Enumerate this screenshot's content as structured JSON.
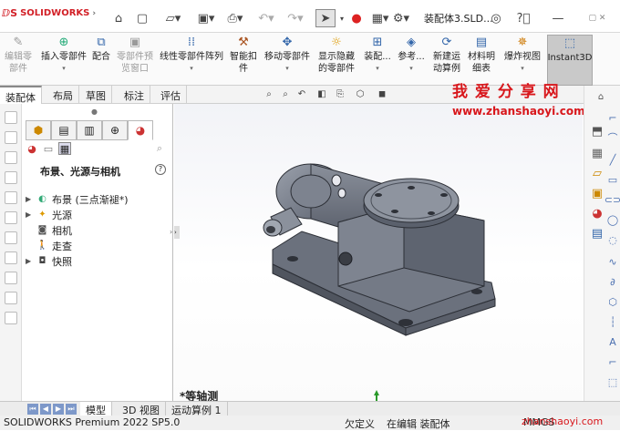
{
  "app": {
    "logo_text": "SOLIDWORKS",
    "document_title": "装配体3.SLD..."
  },
  "quick_access": [
    "home-icon",
    "new-document-icon",
    "open-folder-icon",
    "save-icon",
    "print-icon",
    "undo-icon",
    "redo-icon",
    "select-pointer-icon",
    "traffic-light-icon",
    "options-gear-icon"
  ],
  "title_icons": [
    "user-icon",
    "help-icon",
    "minimize-icon"
  ],
  "ribbon": {
    "buttons": [
      {
        "label": "编辑零\n部件",
        "disabled": true
      },
      {
        "label": "插入零部件",
        "disabled": false
      },
      {
        "label": "配合",
        "disabled": false
      },
      {
        "label": "零部件预\n览窗口",
        "disabled": true
      },
      {
        "label": "线性零部件阵列",
        "disabled": false
      },
      {
        "label": "智能扣\n件",
        "disabled": false
      },
      {
        "label": "移动零部件",
        "disabled": false
      },
      {
        "label": "显示隐藏\n的零部件",
        "disabled": false
      },
      {
        "label": "装配...",
        "disabled": false
      },
      {
        "label": "参考...",
        "disabled": false
      },
      {
        "label": "新建运\n动算例",
        "disabled": false
      },
      {
        "label": "材料明\n细表",
        "disabled": false
      },
      {
        "label": "爆炸视图",
        "disabled": false
      },
      {
        "label": "Instant3D",
        "disabled": false
      }
    ]
  },
  "command_tabs": [
    "装配体",
    "布局",
    "草图",
    "标注",
    "评估"
  ],
  "watermark": {
    "title": "我 爱 分 享 网",
    "url": "www.zhanshaoyi.com",
    "bottom_url": "zhanshaoyi.com"
  },
  "panel": {
    "heading": "布景、光源与相机",
    "help_label": "?",
    "tree": [
      {
        "label": "布景 (三点渐褪*)",
        "icon": "scene-icon"
      },
      {
        "label": "光源",
        "icon": "light-icon"
      },
      {
        "label": "相机",
        "icon": "camera-icon"
      },
      {
        "label": "走查",
        "icon": "walkthrough-icon"
      },
      {
        "label": "快照",
        "icon": "snapshot-icon"
      }
    ]
  },
  "viewport": {
    "view_label": "*等轴测"
  },
  "bottom_tabs": [
    "模型",
    "3D 视图",
    "运动算例 1"
  ],
  "status": {
    "app": "SOLIDWORKS Premium 2022 SP5.0",
    "state": "欠定义",
    "editing": "在编辑 装配体",
    "units": "MMGS"
  },
  "colors": {
    "accent": "#d21f26",
    "watermark": "#d8161b",
    "part_body": "#7a7f8c"
  }
}
